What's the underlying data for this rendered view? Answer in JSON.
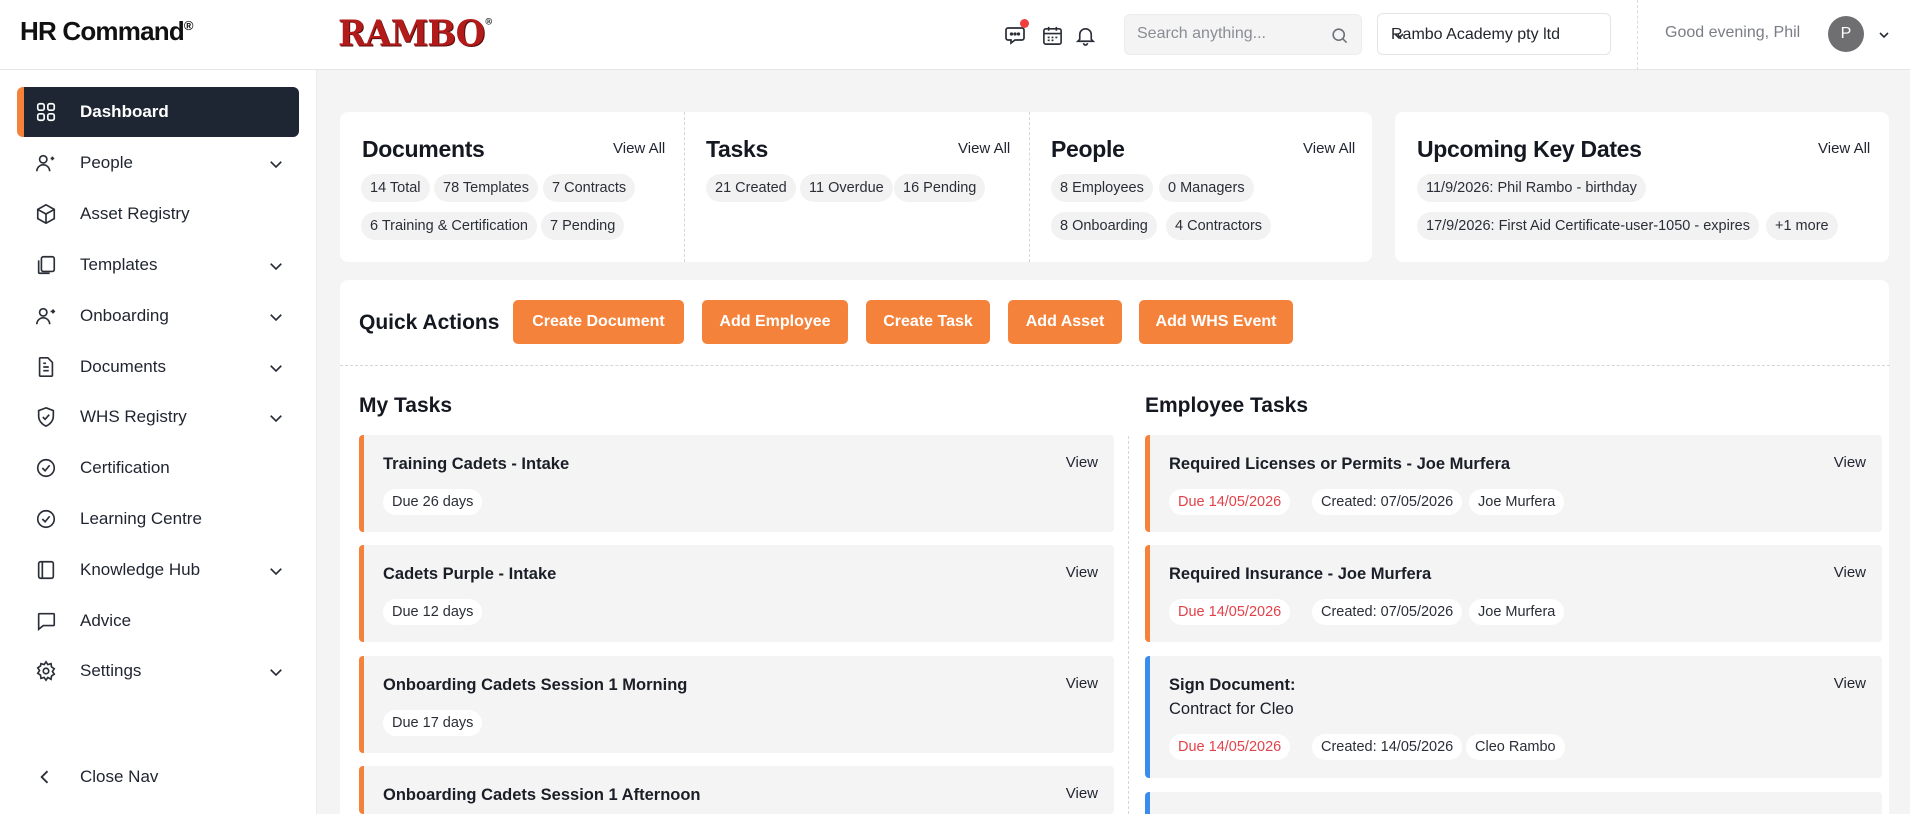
{
  "app": {
    "title": "HR Command",
    "trademark": "®",
    "brand": "RAMBO",
    "brand_mark": "®"
  },
  "header": {
    "search_placeholder": "Search anything...",
    "company": "Rambo Academy pty ltd",
    "greeting": "Good evening, Phil",
    "avatar_initial": "P",
    "icons": [
      "chat-icon",
      "calendar-icon",
      "bell-icon",
      "search-icon",
      "chevron-down-icon"
    ]
  },
  "sidebar": {
    "items": [
      {
        "label": "Dashboard",
        "icon": "grid-icon",
        "active": true,
        "expandable": false
      },
      {
        "label": "People",
        "icon": "user-plus-icon",
        "expandable": true
      },
      {
        "label": "Asset Registry",
        "icon": "box-icon",
        "expandable": false
      },
      {
        "label": "Templates",
        "icon": "copy-icon",
        "expandable": true
      },
      {
        "label": "Onboarding",
        "icon": "user-arrow-icon",
        "expandable": true
      },
      {
        "label": "Documents",
        "icon": "document-icon",
        "expandable": true
      },
      {
        "label": "WHS Registry",
        "icon": "shield-check-icon",
        "expandable": true
      },
      {
        "label": "Certification",
        "icon": "check-circle-icon",
        "expandable": false
      },
      {
        "label": "Learning Centre",
        "icon": "check-circle-icon",
        "expandable": false
      },
      {
        "label": "Knowledge Hub",
        "icon": "book-icon",
        "expandable": true
      },
      {
        "label": "Advice",
        "icon": "message-icon",
        "expandable": false
      },
      {
        "label": "Settings",
        "icon": "gear-icon",
        "expandable": true
      }
    ],
    "close_nav": "Close Nav"
  },
  "summary": {
    "view_all": "View All",
    "documents": {
      "title": "Documents",
      "pills": [
        "14 Total",
        "78 Templates",
        "7 Contracts",
        "6 Training & Certification",
        "7 Pending"
      ]
    },
    "tasks": {
      "title": "Tasks",
      "pills": [
        "21 Created",
        "11 Overdue",
        "16 Pending"
      ]
    },
    "people": {
      "title": "People",
      "pills": [
        "8 Employees",
        "0 Managers",
        "8 Onboarding",
        "4 Contractors"
      ]
    },
    "key_dates": {
      "title": "Upcoming Key Dates",
      "pills": [
        "11/9/2026: Phil Rambo - birthday",
        "17/9/2026: First Aid Certificate-user-1050 - expires",
        "+1 more"
      ]
    }
  },
  "quick_actions": {
    "title": "Quick Actions",
    "buttons": [
      "Create Document",
      "Add Employee",
      "Create Task",
      "Add Asset",
      "Add WHS Event"
    ],
    "accent": "#f5823a"
  },
  "my_tasks": {
    "title": "My Tasks",
    "view": "View",
    "items": [
      {
        "title": "Training Cadets - Intake",
        "due": "Due 26 days"
      },
      {
        "title": "Cadets Purple - Intake",
        "due": "Due 12 days"
      },
      {
        "title": "Onboarding Cadets Session 1 Morning",
        "due": "Due 17 days"
      },
      {
        "title": "Onboarding Cadets Session 1 Afternoon",
        "due": ""
      }
    ]
  },
  "employee_tasks": {
    "title": "Employee Tasks",
    "view": "View",
    "created_label": "Created:",
    "items": [
      {
        "title": "Required Licenses or Permits - Joe Murfera",
        "subtitle": "",
        "due": "Due 14/05/2026",
        "created": "07/05/2026",
        "person": "Joe Murfera",
        "color": "#f5823a"
      },
      {
        "title": "Required Insurance - Joe Murfera",
        "subtitle": "",
        "due": "Due 14/05/2026",
        "created": "07/05/2026",
        "person": "Joe Murfera",
        "color": "#f5823a"
      },
      {
        "title": "Sign Document:",
        "subtitle": "Contract for Cleo",
        "due": "Due 14/05/2026",
        "created": "14/05/2026",
        "person": "Cleo Rambo",
        "color": "#3b8ded"
      }
    ]
  }
}
